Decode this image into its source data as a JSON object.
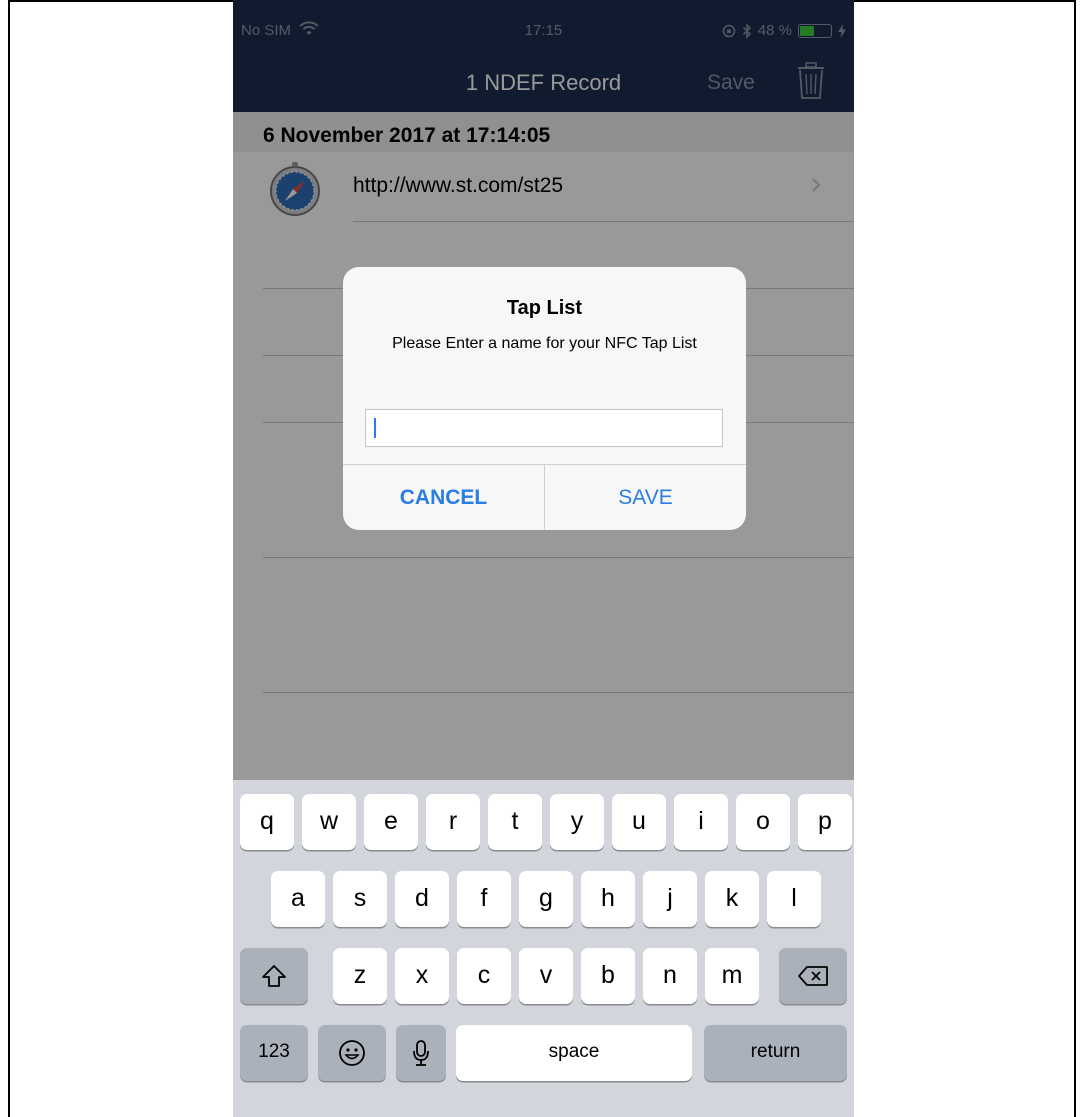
{
  "status_bar": {
    "carrier": "No SIM",
    "time": "17:15",
    "battery_percent": "48 %",
    "battery_level": 0.48
  },
  "nav": {
    "title": "1 NDEF Record",
    "save_label": "Save"
  },
  "list": {
    "section_header": "6 November 2017 at 17:14:05",
    "records": [
      {
        "url": "http://www.st.com/st25",
        "icon": "compass-icon"
      }
    ]
  },
  "alert": {
    "title": "Tap List",
    "message": "Please Enter a name for your NFC Tap List",
    "input_value": "",
    "cancel_label": "CANCEL",
    "save_label": "SAVE"
  },
  "keyboard": {
    "row1": [
      "q",
      "w",
      "e",
      "r",
      "t",
      "y",
      "u",
      "i",
      "o",
      "p"
    ],
    "row2": [
      "a",
      "s",
      "d",
      "f",
      "g",
      "h",
      "j",
      "k",
      "l"
    ],
    "row3": [
      "z",
      "x",
      "c",
      "v",
      "b",
      "n",
      "m"
    ],
    "numbers_label": "123",
    "space_label": "space",
    "return_label": "return"
  },
  "colors": {
    "nav_background": "#1b2e50",
    "accent_blue": "#2a7de1",
    "battery_green": "#3fcf3f"
  }
}
